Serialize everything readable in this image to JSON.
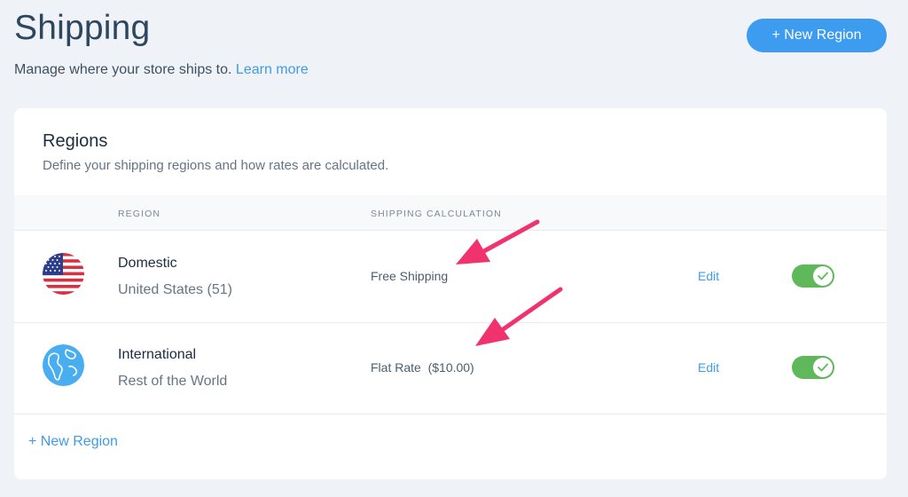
{
  "page": {
    "title": "Shipping",
    "subtitle": "Manage where your store ships to.",
    "learn_more": "Learn more",
    "new_region_button": "+ New Region"
  },
  "regions_card": {
    "title": "Regions",
    "subtitle": "Define your shipping regions and how rates are calculated.",
    "columns": [
      "REGION",
      "SHIPPING CALCULATION"
    ],
    "rows": [
      {
        "icon": "us-flag-icon",
        "name": "Domestic",
        "detail": "United States (51)",
        "calculation": "Free Shipping",
        "edit_label": "Edit",
        "enabled": true
      },
      {
        "icon": "globe-icon",
        "name": "International",
        "detail": "Rest of the World",
        "calculation": "Flat Rate  ($10.00)",
        "edit_label": "Edit",
        "enabled": true
      }
    ],
    "add_region_link": "+ New Region"
  },
  "colors": {
    "accent": "#3d9cf0",
    "toggle_on": "#5fb85a",
    "annotation_arrow": "#f0336e"
  }
}
